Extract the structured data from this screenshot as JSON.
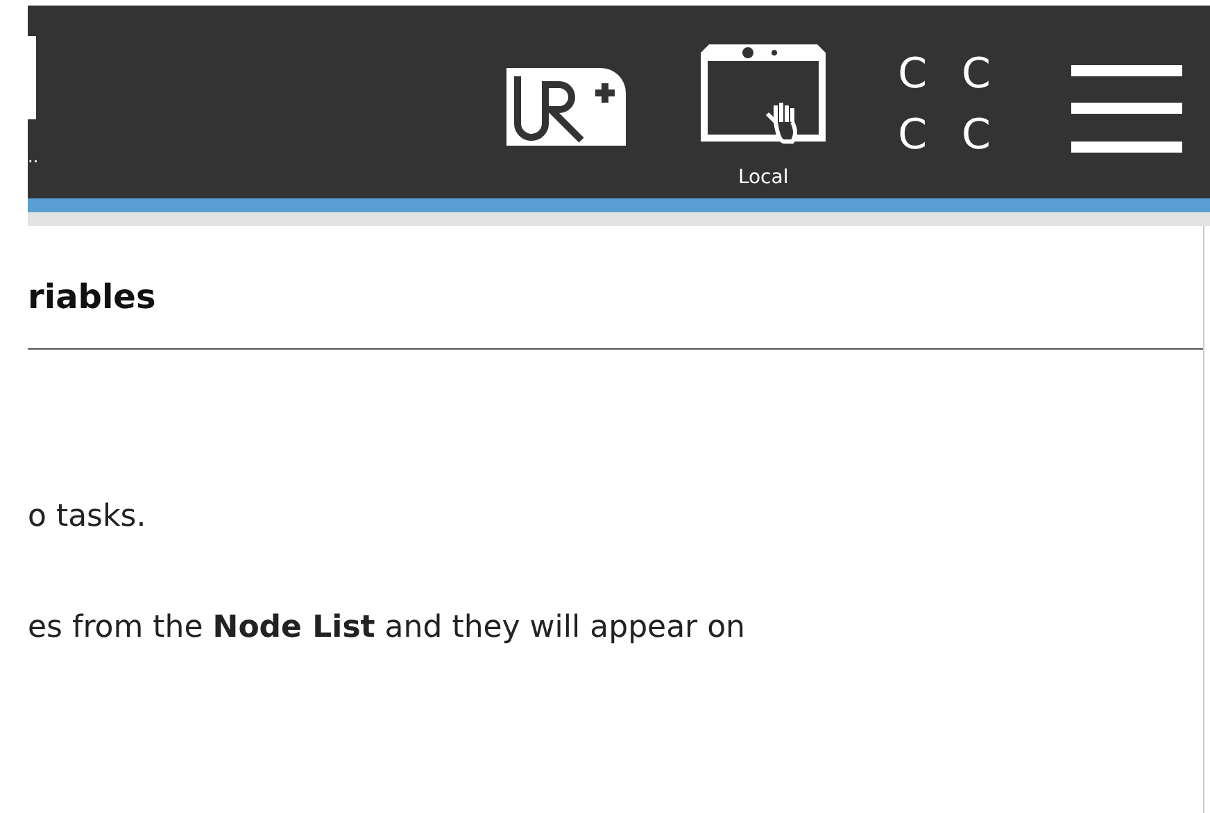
{
  "header": {
    "truncated_label": "..",
    "remote_mode_label": "Local",
    "status_letters": [
      "C",
      "C",
      "C",
      "C"
    ]
  },
  "panel": {
    "title": "riables",
    "paragraphs": [
      "o tasks.",
      "es from the **Node List** and they will appear on"
    ]
  }
}
